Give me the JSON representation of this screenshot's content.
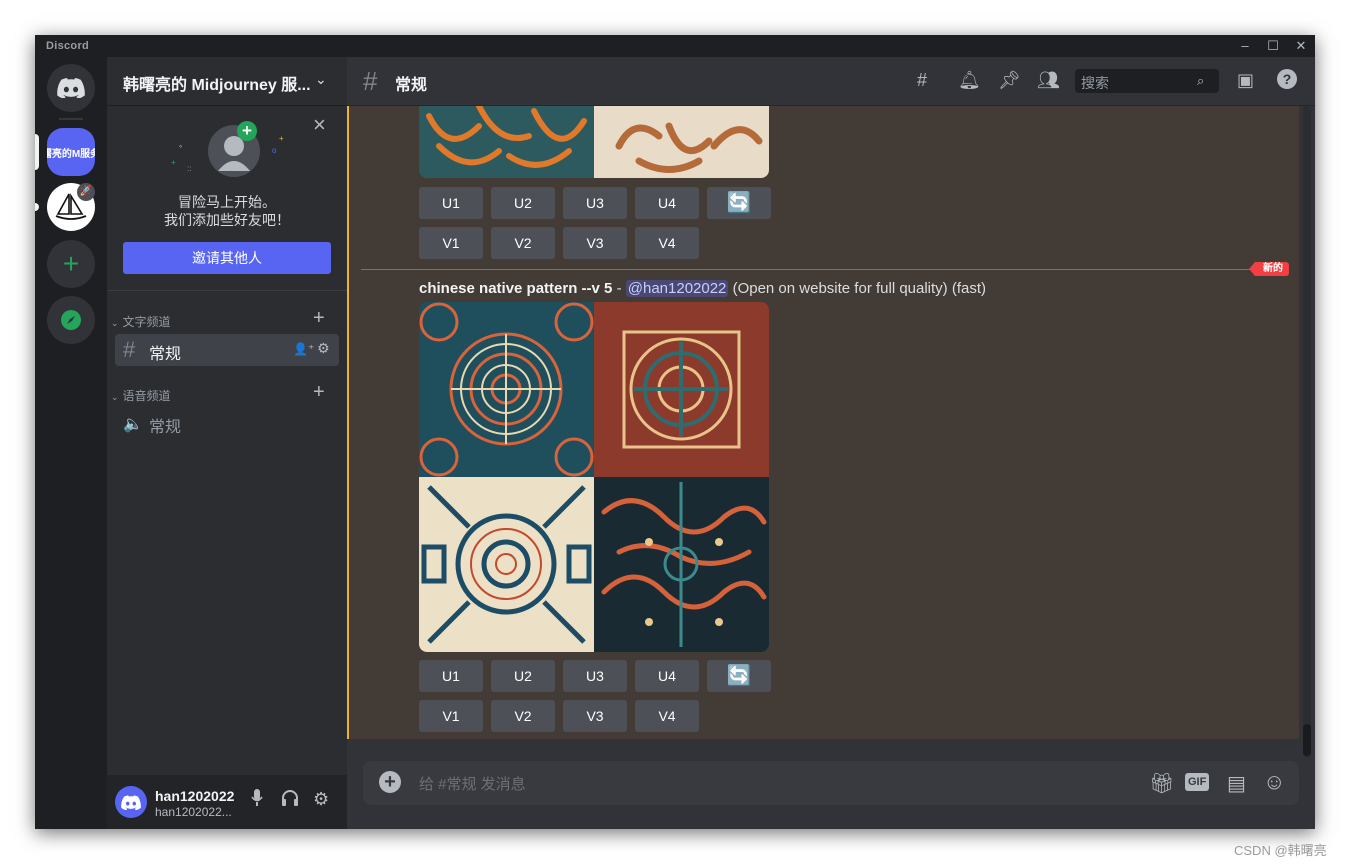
{
  "window": {
    "app_name": "Discord",
    "minimize": "–",
    "maximize": "☐",
    "close": "✕"
  },
  "server": {
    "name": "韩曙亮的 Midjourney 服...",
    "rail_label": "曙亮的M服务"
  },
  "invite": {
    "line1": "冒险马上开始。",
    "line2": "我们添加些好友吧！",
    "button": "邀请其他人"
  },
  "categories": {
    "text": "文字频道",
    "voice": "语音频道"
  },
  "channels": {
    "text_channel": "常规",
    "voice_channel": "常规"
  },
  "user": {
    "name": "han1202022",
    "tag": "han1202022..."
  },
  "header": {
    "channel": "常规",
    "search_placeholder": "搜索"
  },
  "icons": {
    "threads": "threads-icon",
    "bell": "bell-icon",
    "pin": "pin-icon",
    "members": "members-icon",
    "inbox": "inbox-icon",
    "help": "help-icon",
    "gift": "gift-icon",
    "sticker": "sticker-icon",
    "emoji": "emoji-icon",
    "mic": "microphone-icon",
    "headset": "headphones-icon",
    "settings": "gear-icon"
  },
  "colors": {
    "blurple": "#5865f2",
    "green": "#23a55a",
    "red": "#f23f43",
    "highlight": "#f0b232"
  },
  "messages": {
    "new_label": "新的",
    "prompt_bold": "chinese native pattern --v 5",
    "prompt_sep": " - ",
    "mention": "@han1202022",
    "prompt_tail": " (Open on website for full quality) (fast)"
  },
  "buttons": {
    "upscale": [
      "U1",
      "U2",
      "U3",
      "U4"
    ],
    "variation": [
      "V1",
      "V2",
      "V3",
      "V4"
    ],
    "reroll": "🔄"
  },
  "composer": {
    "placeholder": "给 #常规 发消息",
    "gif": "GIF"
  },
  "watermark": "CSDN @韩曙亮"
}
